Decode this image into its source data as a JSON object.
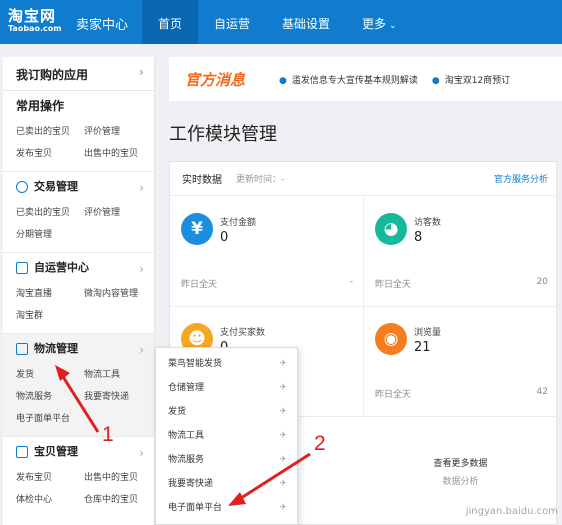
{
  "nav": {
    "logo_cn": "淘宝网",
    "logo_en": "Taobao.com",
    "brand": "卖家中心",
    "items": [
      {
        "label": "首页",
        "active": true
      },
      {
        "label": "自运营"
      },
      {
        "label": "基础设置"
      },
      {
        "label": "更多"
      }
    ]
  },
  "sidebar": {
    "header": "我订购的应用",
    "common": {
      "title": "常用操作",
      "rows": [
        [
          "已卖出的宝贝",
          "评价管理"
        ],
        [
          "发布宝贝",
          "出售中的宝贝"
        ]
      ]
    },
    "trade": {
      "title": "交易管理",
      "rows": [
        [
          "已卖出的宝贝",
          "评价管理"
        ],
        [
          "分期管理",
          ""
        ]
      ]
    },
    "selfops": {
      "title": "自运营中心",
      "rows": [
        [
          "淘宝直播",
          "微淘内容管理"
        ],
        [
          "淘宝群",
          ""
        ]
      ]
    },
    "logistics": {
      "title": "物流管理",
      "rows": [
        [
          "发货",
          "物流工具"
        ],
        [
          "物流服务",
          "我要寄快递"
        ],
        [
          "电子面单平台",
          ""
        ]
      ]
    },
    "goods": {
      "title": "宝贝管理",
      "rows": [
        [
          "发布宝贝",
          "出售中的宝贝"
        ],
        [
          "体检中心",
          "仓库中的宝贝"
        ]
      ]
    }
  },
  "banner": {
    "title": "官方消息",
    "items": [
      "滥发信息专大宣传基本规则解读",
      "淘宝双12商预订"
    ]
  },
  "main": {
    "page_title": "工作模块管理",
    "panel": {
      "title": "实时数据",
      "update_time": "更新时间：-",
      "link": "官方服务分析",
      "cards": [
        {
          "label": "支付金额",
          "value": "0",
          "foot": "昨日全天",
          "right": "-",
          "icon": "yen-icon",
          "color": "#1a8fe0"
        },
        {
          "label": "访客数",
          "value": "8",
          "foot": "昨日全天",
          "right": "20",
          "icon": "footprint-icon",
          "color": "#14b89a"
        },
        {
          "label": "支付买家数",
          "value": "0",
          "foot": "",
          "right": "",
          "icon": "users-icon",
          "color": "#f5a623"
        },
        {
          "label": "浏览量",
          "value": "21",
          "foot": "昨日全天",
          "right": "42",
          "icon": "eye-icon",
          "color": "#f57c1f"
        }
      ],
      "more": "查看更多数据",
      "more_sub": "数据分析"
    }
  },
  "flyout": {
    "items": [
      "菜鸟智能发货",
      "仓储管理",
      "发货",
      "物流工具",
      "物流服务",
      "我要寄快递",
      "电子面单平台"
    ]
  },
  "annotations": {
    "n1": "1",
    "n2": "2"
  },
  "watermark": "jingyan.baidu.com"
}
